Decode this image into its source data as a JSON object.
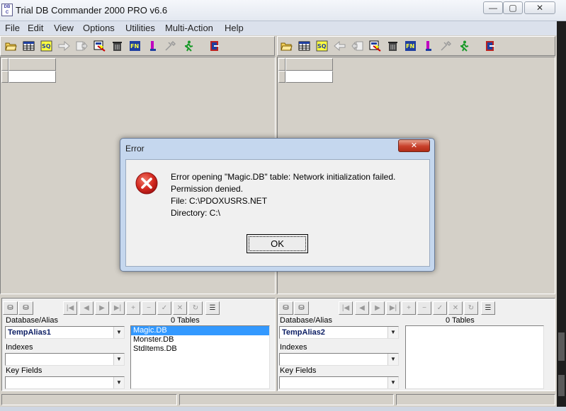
{
  "window": {
    "title": "Trial DB Commander 2000 PRO v6.6",
    "icon_text": "DB C",
    "minimize_glyph": "—",
    "maximize_glyph": "▢",
    "close_glyph": "✕"
  },
  "menu": [
    "File",
    "Edit",
    "View",
    "Options",
    "Utilities",
    "Multi-Action",
    "Help"
  ],
  "toolbar": {
    "icons": [
      "open-folder-icon",
      "table-grid-icon",
      "sql-query-icon",
      "arrow-right-icon",
      "export-icon",
      "filter-icon",
      "trash-icon",
      "field-structure-icon",
      "lowercase-l-icon",
      "tools-icon",
      "run-icon",
      "exit-icon"
    ]
  },
  "left": {
    "database_label": "Database/Alias",
    "alias_value": "TempAlias1",
    "tables_count": "0 Tables",
    "indexes_label": "Indexes",
    "indexes_value": "",
    "keyfields_label": "Key Fields",
    "keyfields_value": "",
    "tables": [
      "Magic.DB",
      "Monster.DB",
      "StdItems.DB"
    ],
    "selected_table": "Magic.DB"
  },
  "right": {
    "database_label": "Database/Alias",
    "alias_value": "TempAlias2",
    "tables_count": "0 Tables",
    "indexes_label": "Indexes",
    "indexes_value": "",
    "keyfields_label": "Key Fields",
    "keyfields_value": "",
    "tables": []
  },
  "navigator": {
    "buttons": [
      "first",
      "prior",
      "next",
      "last",
      "insert",
      "delete",
      "edit",
      "post",
      "cancel",
      "refresh",
      "options"
    ]
  },
  "dialog": {
    "title": "Error",
    "close_glyph": "✕",
    "lines": [
      "Error opening \"Magic.DB\" table: Network initialization failed.",
      "Permission denied.",
      "File: C:\\PDOXUSRS.NET",
      "Directory: C:\\"
    ],
    "ok_label": "OK"
  },
  "colors": {
    "dialog_frame": "#c5d7ee",
    "error_red": "#cc1f1f",
    "selection": "#3399ff",
    "alias_text": "#0b1d63"
  }
}
